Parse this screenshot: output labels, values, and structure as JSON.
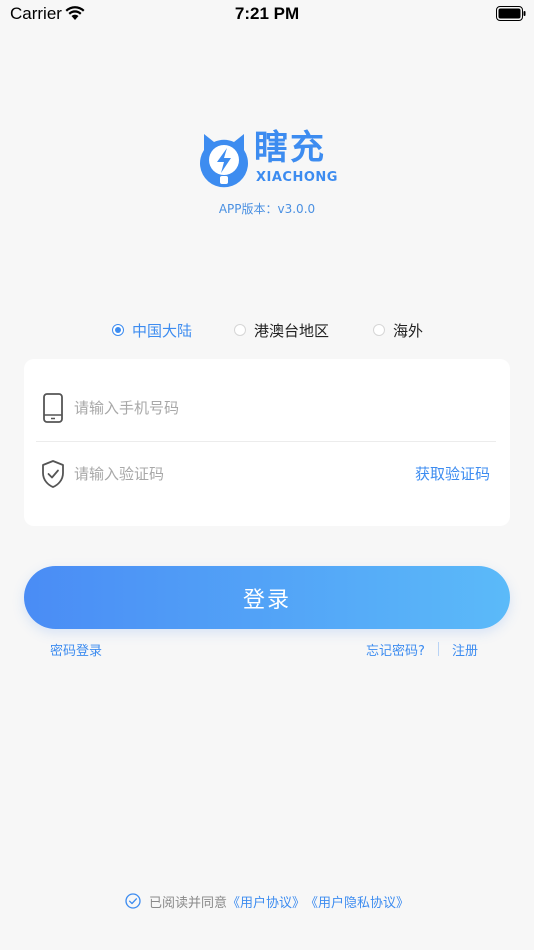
{
  "status_bar": {
    "carrier": "Carrier",
    "time": "7:21 PM"
  },
  "logo": {
    "name_cn": "瞎充",
    "name_en": "XIACHONG",
    "icon": "lightning-cat-icon",
    "brand_color": "#3d8cf0"
  },
  "version": "APP版本：v3.0.0",
  "regions": [
    {
      "label": "中国大陆",
      "selected": true
    },
    {
      "label": "港澳台地区",
      "selected": false
    },
    {
      "label": "海外",
      "selected": false
    }
  ],
  "form": {
    "phone_placeholder": "请输入手机号码",
    "phone_icon": "phone-icon",
    "code_placeholder": "请输入验证码",
    "code_icon": "shield-check-icon",
    "get_code_label": "获取验证码"
  },
  "login_label": "登录",
  "links": {
    "password_login": "密码登录",
    "forgot_password": "忘记密码?",
    "register": "注册"
  },
  "agreement": {
    "prefix": "已阅读并同意",
    "user_agreement": "《用户协议》",
    "privacy_agreement": "《用户隐私协议》",
    "checked": true
  },
  "colors": {
    "accent": "#3d8cf0",
    "gradient_start": "#4a8cf5",
    "gradient_end": "#5bbaf9",
    "background": "#f7f7f7"
  }
}
